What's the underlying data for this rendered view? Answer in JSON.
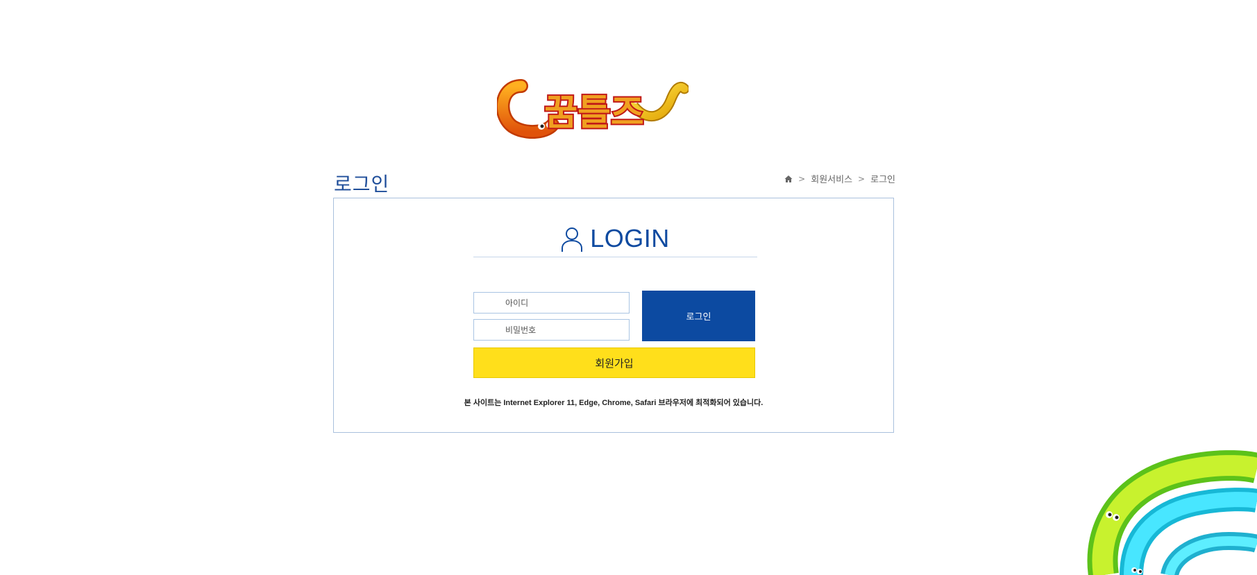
{
  "logo": {
    "text": "꿈틀즈"
  },
  "page": {
    "title": "로그인"
  },
  "breadcrumb": {
    "home": "home-icon",
    "items": [
      "회원서비스",
      "로그인"
    ]
  },
  "login": {
    "heading": "LOGIN",
    "id_placeholder": "아이디",
    "pw_placeholder": "비밀번호",
    "login_button": "로그인",
    "join_button": "회원가입",
    "notice": "본 사이트는 Internet Explorer 11, Edge, Chrome, Safari 브라우저에 최적화되어 있습니다."
  },
  "colors": {
    "accent": "#0c4aa1",
    "join": "#ffdf1b",
    "border": "#a9c0dd"
  }
}
